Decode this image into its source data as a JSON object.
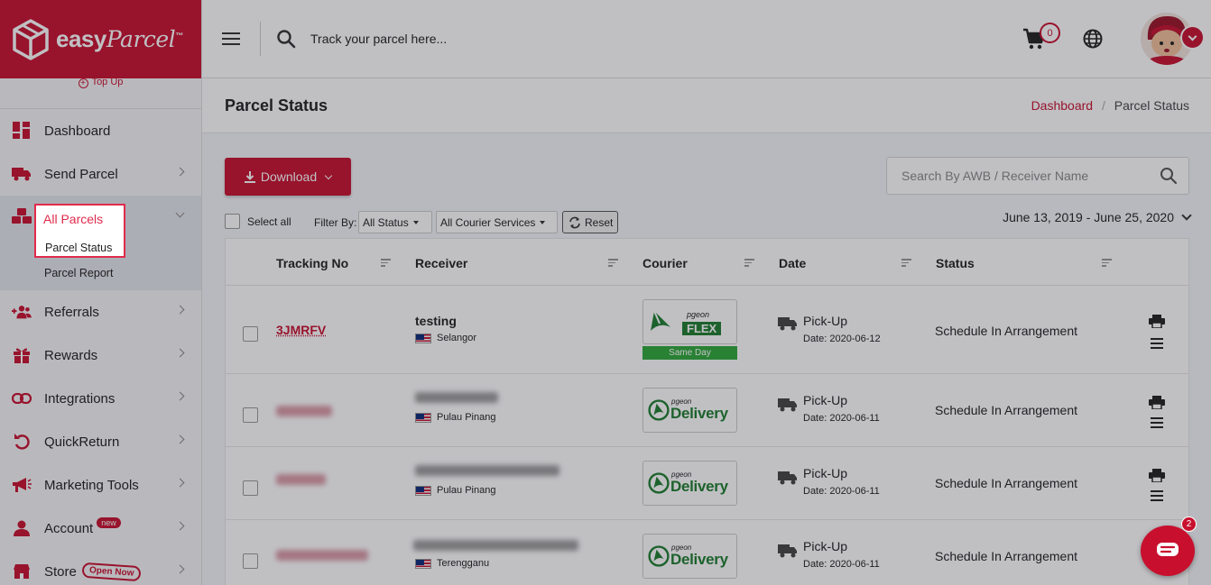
{
  "brand": {
    "logo_word": "easy",
    "logo_script": "Parcel",
    "tm": "™",
    "top_up": "Top Up"
  },
  "sidebar": {
    "items": [
      {
        "label": "Dashboard",
        "icon": "dashboard-icon"
      },
      {
        "label": "Send Parcel",
        "icon": "truck-icon"
      },
      {
        "label": "All Parcels",
        "icon": "boxes-icon",
        "sub": [
          "Parcel Status",
          "Parcel Report"
        ]
      },
      {
        "label": "Referrals",
        "icon": "add-user-icon"
      },
      {
        "label": "Rewards",
        "icon": "gift-icon"
      },
      {
        "label": "Integrations",
        "icon": "link-icon"
      },
      {
        "label": "QuickReturn",
        "icon": "return-icon"
      },
      {
        "label": "Marketing Tools",
        "icon": "megaphone-icon"
      },
      {
        "label": "Account",
        "icon": "user-icon",
        "badge": "new"
      },
      {
        "label": "Store",
        "icon": "store-icon",
        "badge": "Open Now"
      }
    ]
  },
  "topbar": {
    "search_placeholder": "Track your parcel here...",
    "cart_count": "0"
  },
  "page": {
    "title": "Parcel Status",
    "breadcrumb": [
      "Dashboard",
      "Parcel Status"
    ]
  },
  "toolbar": {
    "download_label": "Download",
    "search_placeholder": "Search By AWB / Receiver Name",
    "select_all": "Select all",
    "filter_by": "Filter By:",
    "status_filter": "All Status",
    "courier_filter": "All Courier Services",
    "reset_label": "Reset",
    "date_range": "June 13, 2019 - June 25, 2020"
  },
  "table": {
    "columns": [
      "Tracking No",
      "Receiver",
      "Courier",
      "Date",
      "Status"
    ],
    "rows": [
      {
        "tracking": "3JMRFV",
        "receiver": "testing",
        "location": "Selangor",
        "courier_brand": "pgeon",
        "courier_word": "FLEX",
        "service": "Same Day",
        "event": "Pick-Up",
        "date": "Date: 2020-06-12",
        "status": "Schedule In Arrangement"
      },
      {
        "tracking": "",
        "receiver": "",
        "location": "Pulau Pinang",
        "courier_brand": "pgeon",
        "courier_word": "Delivery",
        "service": "",
        "event": "Pick-Up",
        "date": "Date: 2020-06-11",
        "status": "Schedule In Arrangement"
      },
      {
        "tracking": "",
        "receiver": "",
        "location": "Pulau Pinang",
        "courier_brand": "pgeon",
        "courier_word": "Delivery",
        "service": "",
        "event": "Pick-Up",
        "date": "Date: 2020-06-11",
        "status": "Schedule In Arrangement"
      },
      {
        "tracking": "",
        "receiver": "",
        "location": "Terengganu",
        "courier_brand": "pgeon",
        "courier_word": "Delivery",
        "service": "",
        "event": "Pick-Up",
        "date": "Date: 2020-06-11",
        "status": "Schedule In Arrangement"
      }
    ]
  },
  "chat": {
    "badge": "2"
  },
  "colors": {
    "brand": "#c8102e",
    "highlight": "#e02b4c",
    "courier_green": "#1e7d2e"
  }
}
